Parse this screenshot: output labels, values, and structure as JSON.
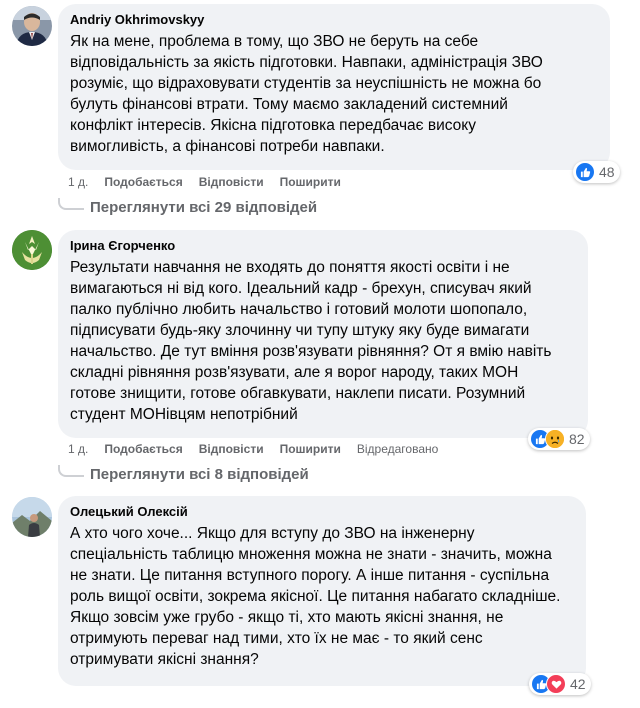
{
  "comments": [
    {
      "author": "Andriy Okhrimovskyy",
      "lines": [
        "Як на мене, проблема в тому, що ЗВО не беруть на себе",
        "відповідальність за якість підготовки. Навпаки, адміністрація ЗВО",
        "розуміє, що відраховувати студентів за неуспішність не можна бо",
        "булуть фінансові втрати. Тому маємо закладений системний",
        "конфлікт інтересів. Якісна підготовка передбачає високу",
        "вимогливість, а фінансові потреби навпаки."
      ],
      "reaction_count": "48",
      "reactions": [
        "like-icon"
      ],
      "time": "1 д.",
      "like_label": "Подобається",
      "reply_label": "Відповісти",
      "share_label": "Поширити",
      "edited": "",
      "view_replies": "Переглянути всі 29 відповідей"
    },
    {
      "author": "Ірина Єгорченко",
      "lines": [
        "Результати навчання не входять до поняття якості освіти і не",
        "вимагаються ні від кого. Ідеальний кадр - брехун, списувач який",
        "палко публічно любить начальство і готовий молоти шопопало,",
        "підписувати будь-яку злочинну чи тупу штуку яку буде вимагати",
        "начальство. Де тут вміння розв'язувати рівняння? От я вмію навіть",
        "складні рівняння розв'язувати, але я ворог народу, таких МОН",
        "готове знищити, готове обгавкувати, наклепи писати. Розумний",
        "студент МОНівцям непотрібний"
      ],
      "reaction_count": "82",
      "reactions": [
        "like-icon",
        "sad-icon"
      ],
      "time": "1 д.",
      "like_label": "Подобається",
      "reply_label": "Відповісти",
      "share_label": "Поширити",
      "edited": "Відредаговано",
      "view_replies": "Переглянути всі 8 відповідей"
    },
    {
      "author": "Олецький Олексій",
      "lines": [
        "А хто чого хоче... Якщо для вступу до ЗВО на інженерну",
        "спеціальність таблицю множення можна не знати - значить, можна",
        "не знати. Це питання вступного порогу. А інше питання - суспільна",
        "роль вищої освіти, зокрема якісної. Це питання набагато складніше.",
        "Якщо зовсім уже грубо - якщо ті, хто мають якісні знання, не",
        "отримують переваг над тими, хто їх не має - то який сенс",
        "отримувати якісні знання?"
      ],
      "reaction_count": "42",
      "reactions": [
        "like-icon",
        "love-icon"
      ],
      "time": "",
      "like_label": "",
      "reply_label": "",
      "share_label": "",
      "edited": "",
      "view_replies": ""
    }
  ],
  "colors": {
    "bubble": "#f0f2f5",
    "secondary_text": "#65676b",
    "like_blue": "#1877f2",
    "love_red": "#f33e58",
    "sad_yellow": "#f7b125"
  }
}
